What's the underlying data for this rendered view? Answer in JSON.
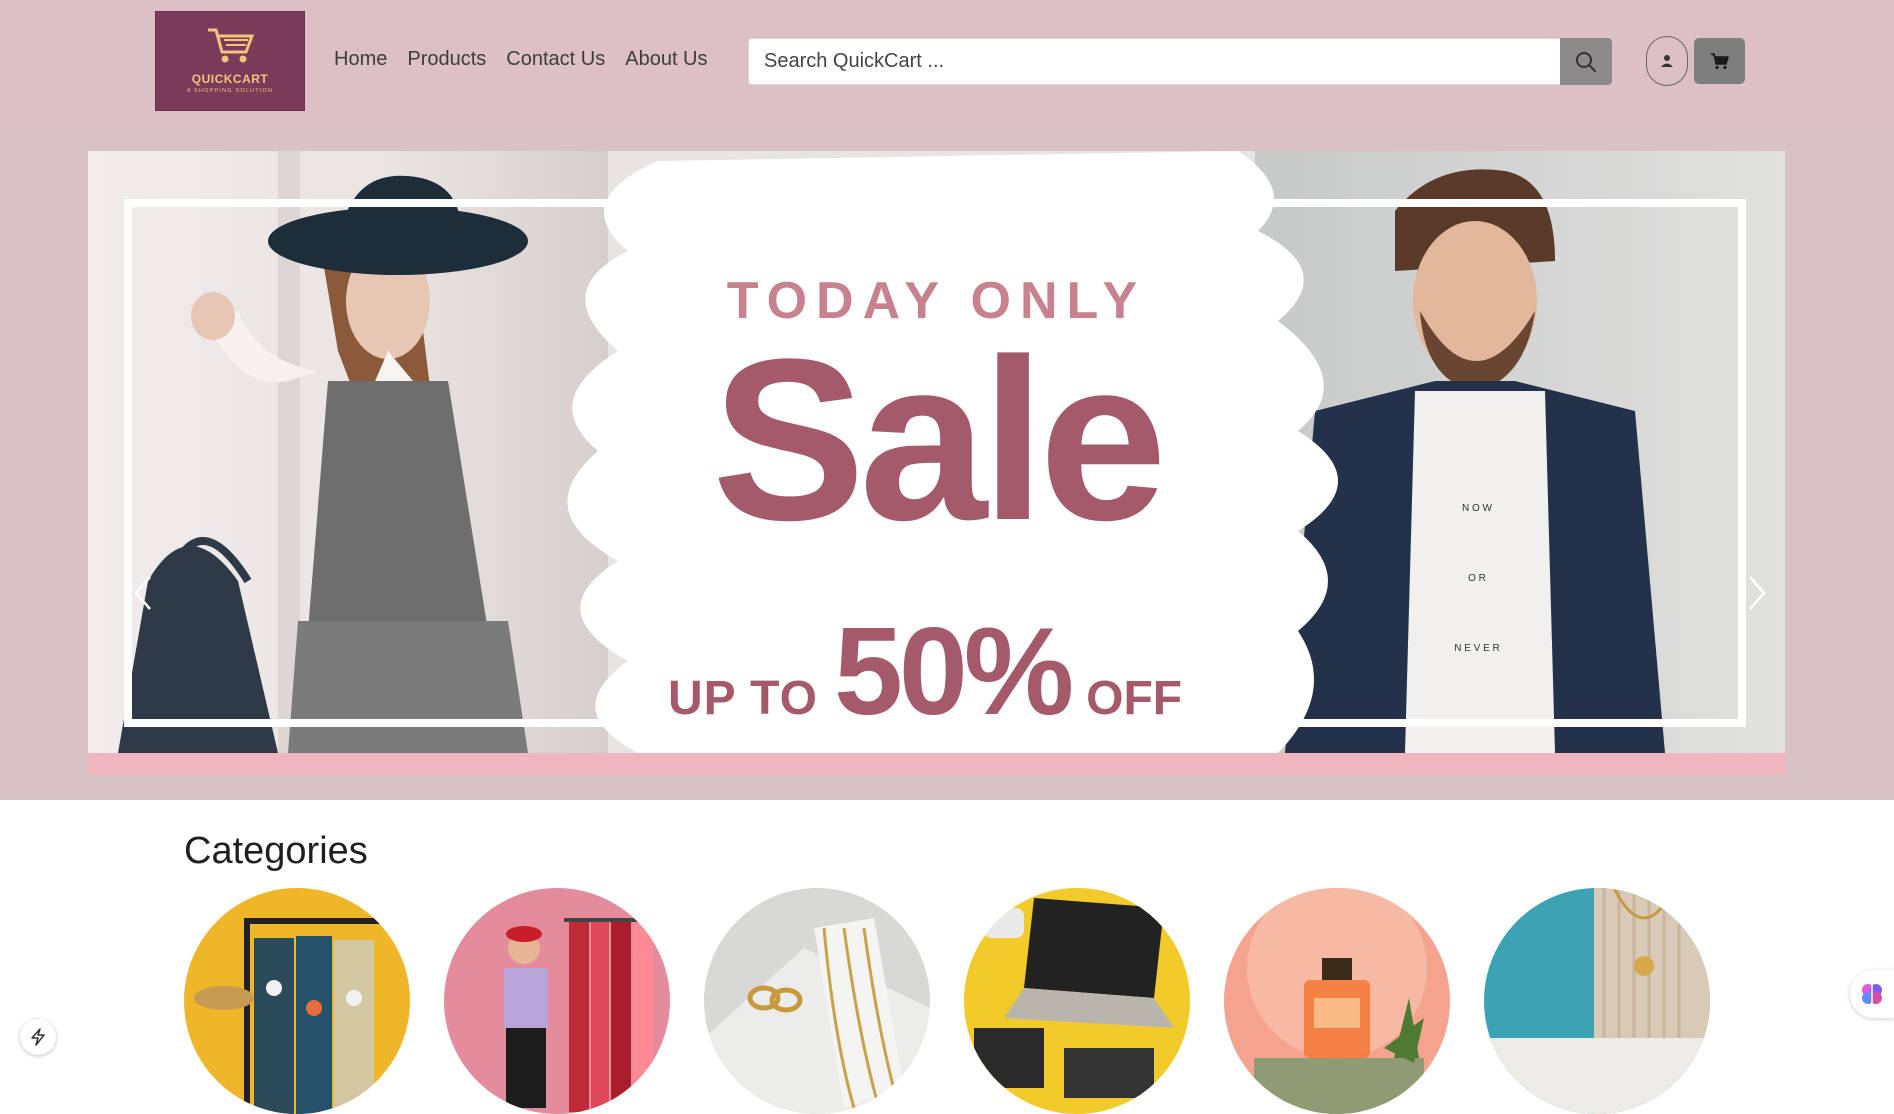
{
  "header": {
    "logo_text": "QUICKCART",
    "logo_tagline": "A SHOPPING SOLUTION",
    "nav": [
      "Home",
      "Products",
      "Contact Us",
      "About Us"
    ],
    "search_placeholder": "Search QuickCart ...",
    "icons": {
      "search": "search-icon",
      "user": "user-icon",
      "cart": "cart-icon"
    }
  },
  "hero": {
    "line1": "TODAY ONLY",
    "line2": "Sale",
    "prefix": "UP TO",
    "percent": "50%",
    "suffix": "OFF",
    "shirt_text": [
      "N O W",
      "O R",
      "N E V E R"
    ],
    "prev_icon": "chevron-left-icon",
    "next_icon": "chevron-right-icon",
    "colors": {
      "accent": "#a45a6b",
      "accent_light": "#c8818e",
      "header_bg": "#dcc0c6"
    }
  },
  "categories": {
    "title": "Categories",
    "items": [
      {
        "image": "clothing-rack-image"
      },
      {
        "image": "fashion-woman-image"
      },
      {
        "image": "gold-chains-image"
      },
      {
        "image": "electronics-laptop-image"
      },
      {
        "image": "perfume-bottle-image"
      },
      {
        "image": "jewelry-pendant-image"
      }
    ]
  }
}
